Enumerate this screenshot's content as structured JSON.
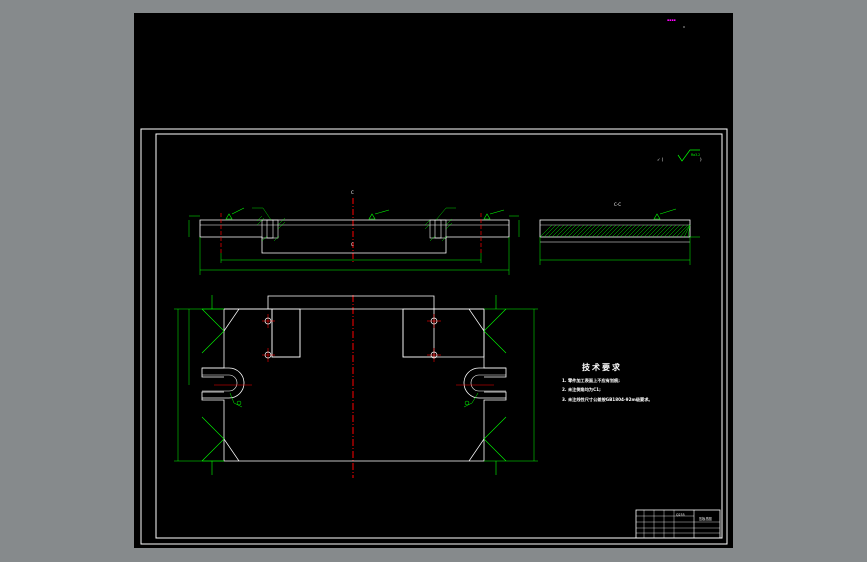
{
  "sheet": {
    "section_label_top": "C",
    "section_label_bottom": "C",
    "section_view_title": "C-C",
    "top_corner_mark": "▪▪▪▪",
    "roughness_mark": "Ra3.2"
  },
  "technical_requirements": {
    "title": "技术要求",
    "items": [
      "1. 零件加工表面上不应有划痕;",
      "2. 未注倒角均为C1;",
      "3. 未注线性尺寸公差按GB1804-92m级要求。"
    ]
  },
  "title_block": {
    "part_name": "压板总图",
    "material": "Q235"
  },
  "colors": {
    "background_outer": "#868a8c",
    "paper": "#000000",
    "outline": "#ffffff",
    "dimension": "#00ff00",
    "center_line": "#ff0000",
    "hatch": "#00ff00",
    "mark": "#ff00ff"
  }
}
